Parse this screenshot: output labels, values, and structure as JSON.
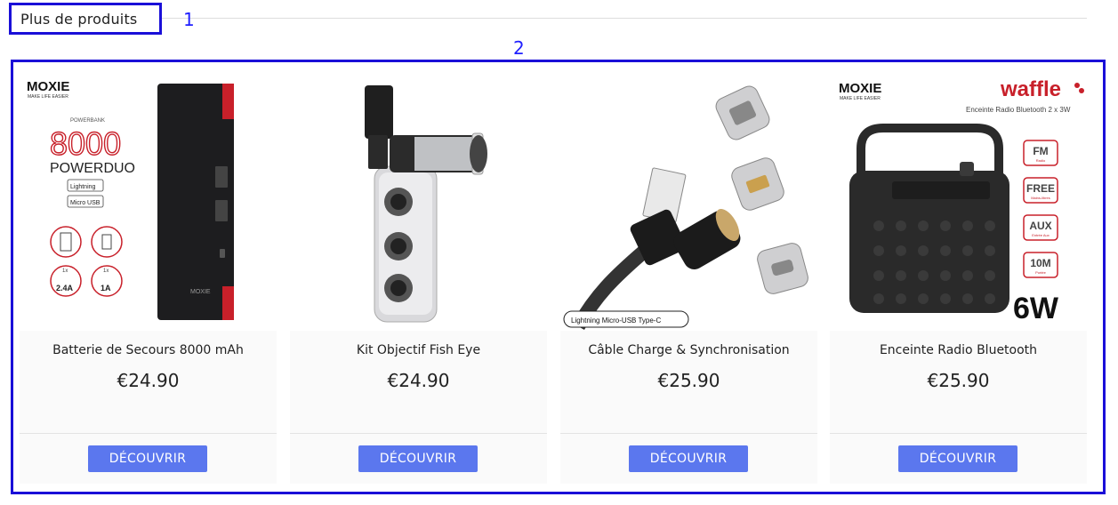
{
  "section": {
    "title": "Plus de produits",
    "annotation_1": "1",
    "annotation_2": "2"
  },
  "products": [
    {
      "name": "Batterie de Secours 8000 mAh",
      "price": "€24.90",
      "cta": "DÉCOUVRIR",
      "image_text": {
        "brand": "MOXIE",
        "tagline": "MAKE LIFE EASIER",
        "powerbank": "POWERBANK",
        "capacity": "8000",
        "series": "POWERDUO",
        "input1": "Lightning",
        "input2": "Micro USB",
        "out1": "2.4A",
        "out2": "1A",
        "out_count": "1x"
      }
    },
    {
      "name": "Kit Objectif Fish Eye",
      "price": "€24.90",
      "cta": "DÉCOUVRIR"
    },
    {
      "name": "Câble Charge & Synchronisation",
      "price": "€25.90",
      "cta": "DÉCOUVRIR",
      "image_text": {
        "connectors": "Lightning  Micro-USB  Type-C"
      }
    },
    {
      "name": "Enceinte Radio Bluetooth",
      "price": "€25.90",
      "cta": "DÉCOUVRIR",
      "image_text": {
        "brand": "MOXIE",
        "tagline": "MAKE LIFE EASIER",
        "sub_brand": "waffle",
        "subtitle": "Enceinte Radio Bluetooth 2 x 3W",
        "f1": "FM",
        "f1s": "Radio",
        "f2": "FREE",
        "f2s": "Mains-libres",
        "f3": "AUX",
        "f3s": "Entrée Aux",
        "f4": "10M",
        "f4s": "Portée",
        "power": "6W"
      }
    }
  ],
  "colors": {
    "annotation": "#1a0fd8",
    "button": "#5b77ee",
    "accent_red": "#c8202a"
  }
}
